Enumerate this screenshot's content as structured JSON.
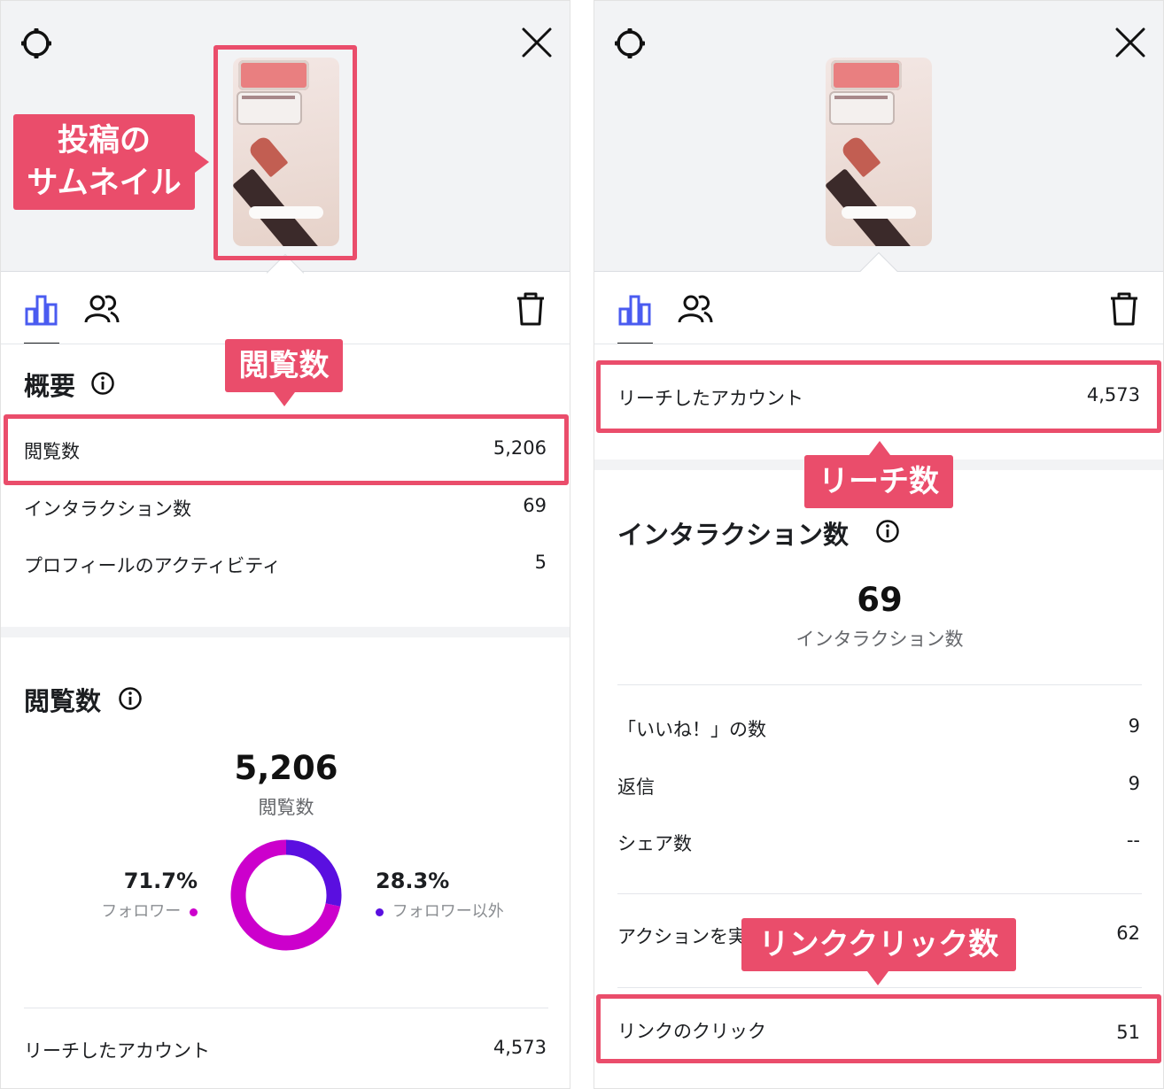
{
  "colors": {
    "accent_red": "#ea4d6b",
    "insights_blue": "#4a5bf0",
    "followers": "#cc00cc",
    "non_followers": "#5a0fe0"
  },
  "icons": {
    "settings": "gear-icon",
    "close": "close-icon",
    "insights_tab": "bar-chart-icon",
    "audience_tab": "people-icon",
    "delete": "trash-icon",
    "info": "info-icon"
  },
  "left": {
    "thumbnail_callout": [
      "投稿の",
      "サムネイル"
    ],
    "views_callout": "閲覧数",
    "overview": {
      "title": "概要",
      "rows": [
        {
          "label": "閲覧数",
          "value": "5,206"
        },
        {
          "label": "インタラクション数",
          "value": "69"
        },
        {
          "label": "プロフィールのアクティビティ",
          "value": "5"
        }
      ]
    },
    "views_section": {
      "title": "閲覧数",
      "total": "5,206",
      "caption": "閲覧数",
      "followers_pct": "71.7%",
      "followers_label": "フォロワー",
      "non_followers_pct": "28.3%",
      "non_followers_label": "フォロワー以外"
    },
    "reach_row": {
      "label": "リーチしたアカウント",
      "value": "4,573"
    }
  },
  "right": {
    "reach_row": {
      "label": "リーチしたアカウント",
      "value": "4,573"
    },
    "reach_callout": "リーチ数",
    "interactions": {
      "title": "インタラクション数",
      "total": "69",
      "caption": "インタラクション数",
      "rows": [
        {
          "label": "「いいね！」の数",
          "value": "9"
        },
        {
          "label": "返信",
          "value": "9"
        },
        {
          "label": "シェア数",
          "value": "--"
        }
      ]
    },
    "actions_row": {
      "label": "アクションを実",
      "value": "62"
    },
    "link_click_callout": "リンククリック数",
    "link_click_row": {
      "label": "リンクのクリック",
      "value": "51"
    }
  },
  "chart_data": {
    "type": "pie",
    "categories": [
      "フォロワー",
      "フォロワー以外"
    ],
    "values": [
      71.7,
      28.3
    ],
    "title": "",
    "colors": [
      "#cc00cc",
      "#5a0fe0"
    ]
  }
}
